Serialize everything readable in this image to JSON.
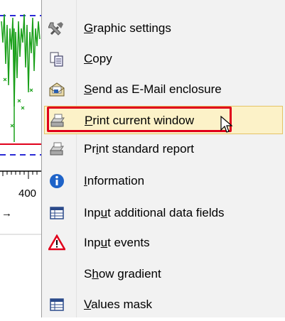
{
  "background": {
    "axis_tick_label": "400",
    "arrow_glyph": "→"
  },
  "menu": {
    "items": [
      {
        "id": "graphic-settings",
        "pre": "",
        "acc": "G",
        "post": "raphic settings",
        "icon": "tools-icon"
      },
      {
        "id": "copy",
        "pre": "",
        "acc": "C",
        "post": "opy",
        "icon": "copy-icon"
      },
      {
        "id": "send-email",
        "pre": "",
        "acc": "S",
        "post": "end as E-Mail enclosure",
        "icon": "email-icon"
      },
      {
        "id": "print-current",
        "pre": "",
        "acc": "P",
        "post": "rint current window",
        "icon": "printer-icon",
        "highlighted": true
      },
      {
        "id": "print-standard",
        "pre": "Pr",
        "acc": "i",
        "post": "nt standard report",
        "icon": "printer-icon"
      },
      {
        "id": "information",
        "pre": "",
        "acc": "I",
        "post": "nformation",
        "icon": "info-icon"
      },
      {
        "id": "input-additional",
        "pre": "Inp",
        "acc": "u",
        "post": "t additional data fields",
        "icon": "table-icon"
      },
      {
        "id": "input-events",
        "pre": "Inp",
        "acc": "u",
        "post": "t events",
        "icon": "warning-icon"
      },
      {
        "id": "show-gradient",
        "pre": "S",
        "acc": "h",
        "post": "ow gradient",
        "icon": ""
      },
      {
        "id": "values-mask",
        "pre": "",
        "acc": "V",
        "post": "alues mask",
        "icon": "table-icon"
      }
    ]
  },
  "colors": {
    "highlight_bg": "#fcf2c8",
    "highlight_border": "#e5c365",
    "annotation_red": "#e0001b",
    "plot_green": "#1aa01a"
  }
}
